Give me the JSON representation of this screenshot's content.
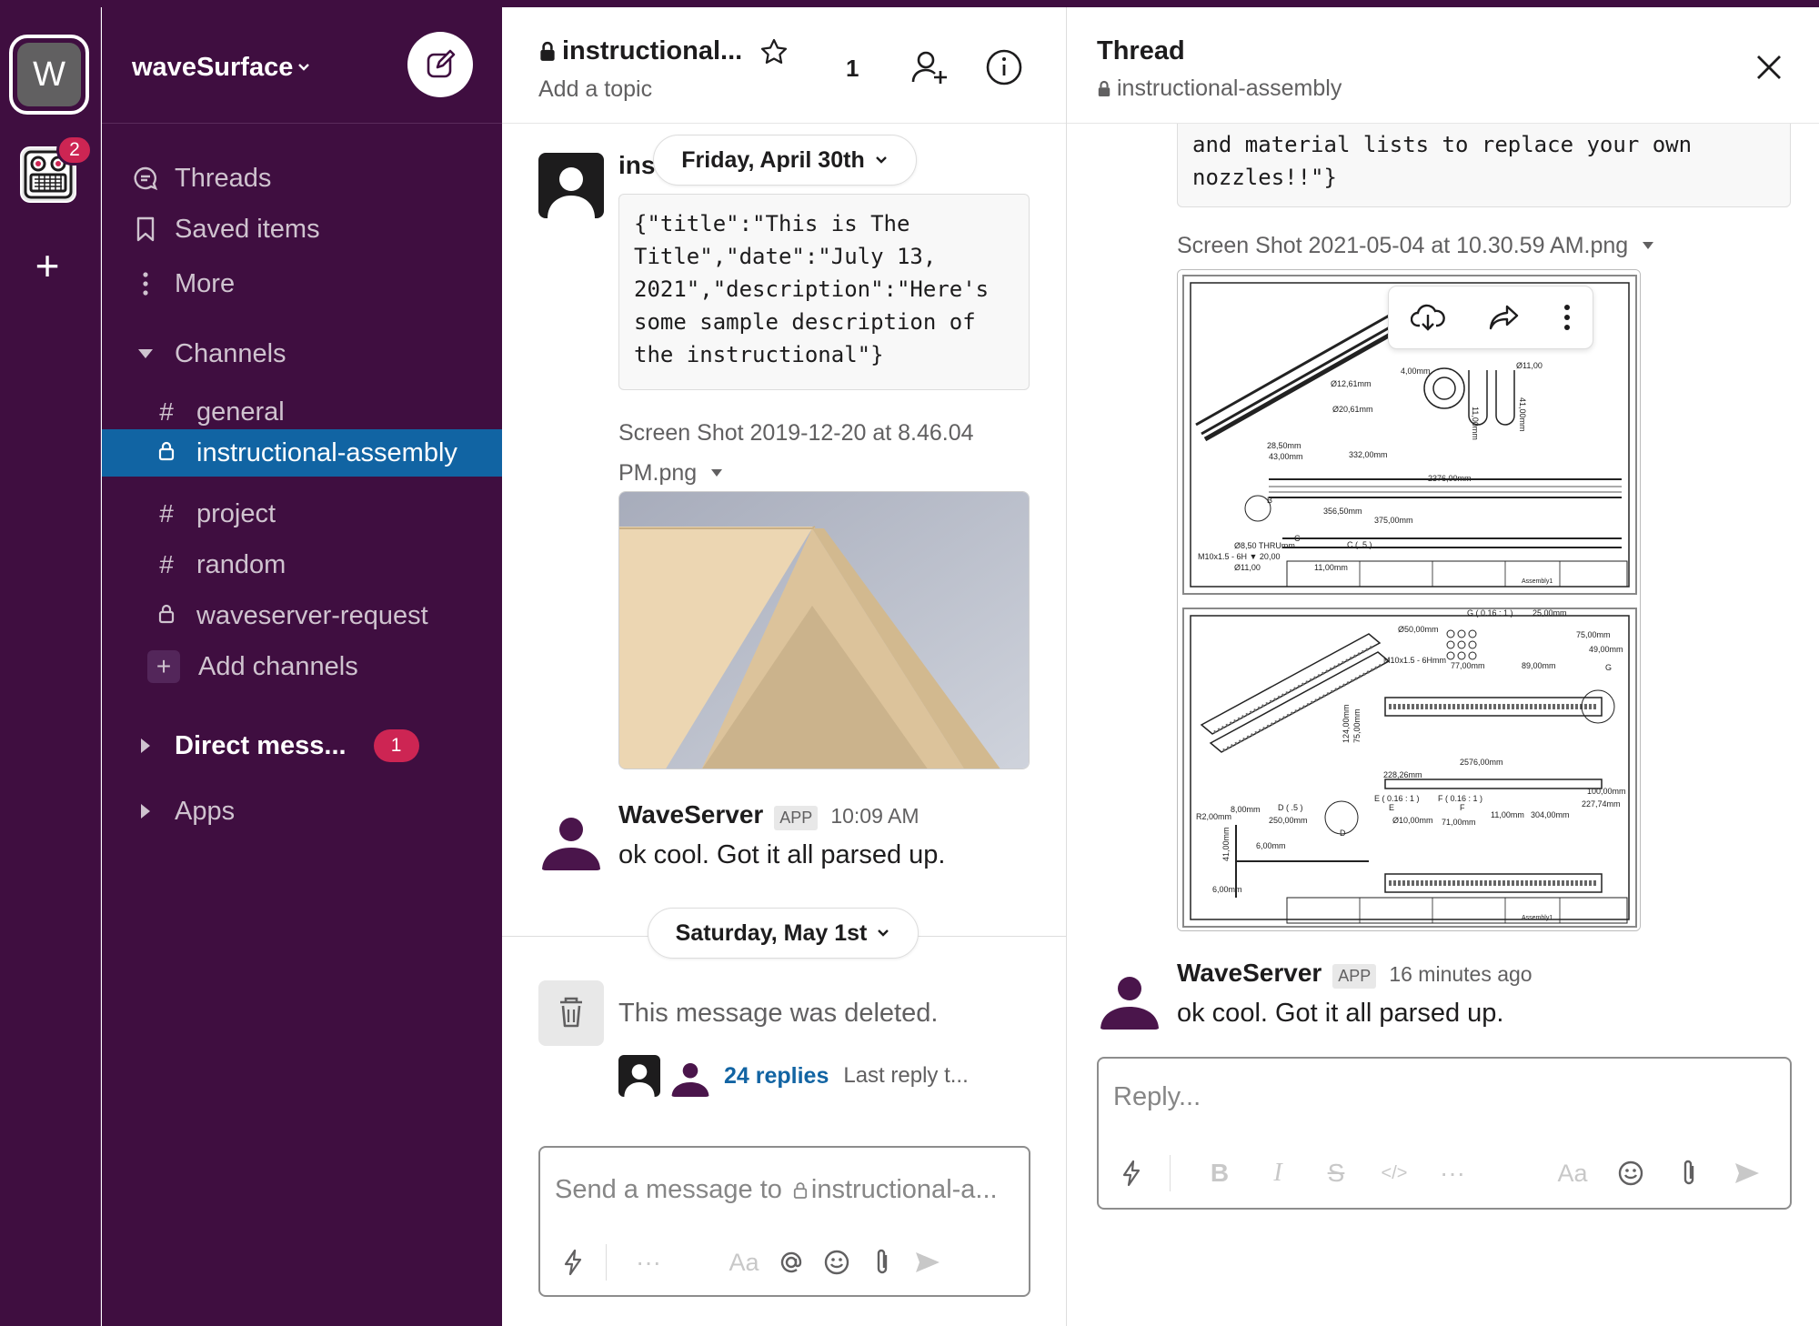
{
  "workspace": {
    "initial": "W",
    "name": "waveSurface",
    "app_badge": "2"
  },
  "sidebar": {
    "nav": [
      {
        "label": "Threads",
        "icon": "threads-icon"
      },
      {
        "label": "Saved items",
        "icon": "bookmark-icon"
      },
      {
        "label": "More",
        "icon": "more-vertical-icon"
      }
    ],
    "channels_label": "Channels",
    "channels": [
      {
        "label": "general",
        "icon": "#"
      },
      {
        "label": "instructional-assembly",
        "icon": "lock",
        "active": true
      },
      {
        "label": "project",
        "icon": "#"
      },
      {
        "label": "random",
        "icon": "#"
      },
      {
        "label": "waveserver-request",
        "icon": "lock"
      }
    ],
    "add_channels": "Add channels",
    "direct_messages": "Direct mess...",
    "dm_badge": "1",
    "apps": "Apps"
  },
  "channel": {
    "title": "instructional...",
    "topic": "Add a topic",
    "member_count": "1",
    "partial_name": "ins",
    "date_1": "Friday, April 30th",
    "code_message": "{\"title\":\"This is The\nTitle\",\"date\":\"July 13,\n2021\",\"description\":\"Here's\nsome sample description of\nthe instructional\"}",
    "file_name_line1": "Screen Shot 2019-12-20 at 8.46.04",
    "file_name_line2": "PM.png",
    "app_message": {
      "name": "WaveServer",
      "tag": "APP",
      "time": "10:09 AM",
      "text": "ok cool. Got it all parsed up."
    },
    "date_2": "Saturday, May 1st",
    "deleted_text": "This message was deleted.",
    "replies": "24 replies",
    "last_reply": "Last reply t...",
    "composer_placeholder_prefix": "Send a message to",
    "composer_placeholder_channel": "instructional-a..."
  },
  "thread": {
    "title": "Thread",
    "channel": "instructional-assembly",
    "code_tail": "and material lists to replace your own\nnozzles!!\"}",
    "file_name": "Screen Shot 2021-05-04 at 10.30.59 AM.png",
    "reply": {
      "name": "WaveServer",
      "tag": "APP",
      "time": "16 minutes ago",
      "text": "ok cool. Got it all parsed up."
    },
    "reply_placeholder": "Reply...",
    "drawing_1_labels": [
      "4,00mm",
      "Ø12,61mm",
      "Ø20,61mm",
      "Ø11,00",
      "11,00mm",
      "41,00mm",
      "28,50mm",
      "43,00mm",
      "332,00mm",
      "2376,00mm",
      "356,50mm",
      "375,00mm",
      "Ø8,50 THRUmm",
      "M10x1.5 - 6H ▼ 20,00",
      "Ø11,00",
      "11,00mm",
      "C ( .5 )",
      "B",
      "C"
    ],
    "drawing_2_labels": [
      "G ( 0.16 : 1 )",
      "25,00mm",
      "Ø50,00mm",
      "75,00mm",
      "49,00mm",
      "M10x1.5 - 6Hmm",
      "77,00mm",
      "89,00mm",
      "124,00mm",
      "75,00mm",
      "2576,00mm",
      "228,26mm",
      "E ( 0.16 : 1 )",
      "F ( 0.16 : 1 )",
      "100,00mm",
      "227,74mm",
      "304,00mm",
      "R2,00mm",
      "8,00mm",
      "D ( .5 )",
      "250,00mm",
      "Ø10,00mm",
      "71,00mm",
      "11,00mm",
      "41,00mm",
      "6,00mm",
      "6,00mm",
      "D",
      "E",
      "F",
      "G"
    ],
    "title_block": "Assembly1"
  },
  "colors": {
    "aubergine": "#3f0e40",
    "active_blue": "#1164a3",
    "badge_red": "#cd2553",
    "link_blue": "#1264a3"
  }
}
